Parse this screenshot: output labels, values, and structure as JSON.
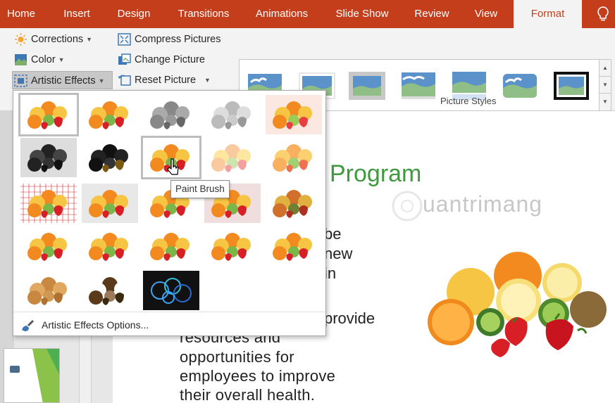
{
  "ribbon_tabs": [
    "Home",
    "Insert",
    "Design",
    "Transitions",
    "Animations",
    "Slide Show",
    "Review",
    "View",
    "Format"
  ],
  "active_tab": "Format",
  "adjust_group": {
    "corrections": "Corrections",
    "color": "Color",
    "artistic_effects": "Artistic Effects",
    "compress": "Compress Pictures",
    "change": "Change Picture",
    "reset": "Reset Picture"
  },
  "picture_styles_label": "Picture Styles",
  "artistic_effects_menu": {
    "tooltip": "Paint Brush",
    "options_label": "Artistic Effects Options...",
    "selected_index": 7,
    "hovered_index": 7,
    "effect_count": 23
  },
  "slide": {
    "title_fragment": "Program",
    "watermark": "uantrimang",
    "fragments_right": [
      "be",
      "new",
      "in",
      "provide"
    ],
    "body_lines": [
      "resources and",
      "opportunities for",
      "employees to improve",
      "their overall health."
    ]
  },
  "colors": {
    "ribbon_accent": "#c43e1c",
    "ribbon_bg": "#f3f3f3",
    "title_green": "#3f9a3f"
  },
  "icons": {
    "corrections": "sun-icon",
    "color": "color-swatch-icon",
    "artistic": "artistic-effects-icon",
    "compress": "compress-icon",
    "change": "change-picture-icon",
    "reset": "reset-picture-icon",
    "help": "lightbulb-icon",
    "options": "paint-brush-icon"
  }
}
